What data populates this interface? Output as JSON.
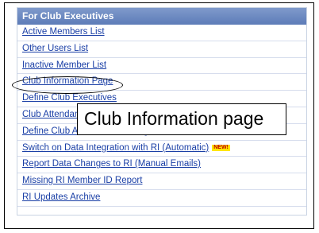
{
  "menu": {
    "header": "For Club Executives",
    "items": [
      {
        "label": "Active Members List"
      },
      {
        "label": "Other Users List"
      },
      {
        "label": "Inactive Member List"
      },
      {
        "label": "Club Information Page"
      },
      {
        "label": "Define Club Executives"
      },
      {
        "label": "Club Attendance"
      },
      {
        "label": "Define Club Attendance Manager"
      },
      {
        "label": "Switch on Data Integration with RI (Automatic)",
        "badge": "NEW!"
      },
      {
        "label": "Report Data Changes to RI (Manual Emails)"
      },
      {
        "label": "Missing RI Member ID Report"
      },
      {
        "label": "RI Updates Archive"
      }
    ]
  },
  "callout": {
    "text": "Club Information page"
  },
  "colors": {
    "header_bg": "#6d8bc2",
    "link": "#1a3fa6",
    "badge_bg": "#ffe600",
    "badge_text": "#c00000"
  }
}
